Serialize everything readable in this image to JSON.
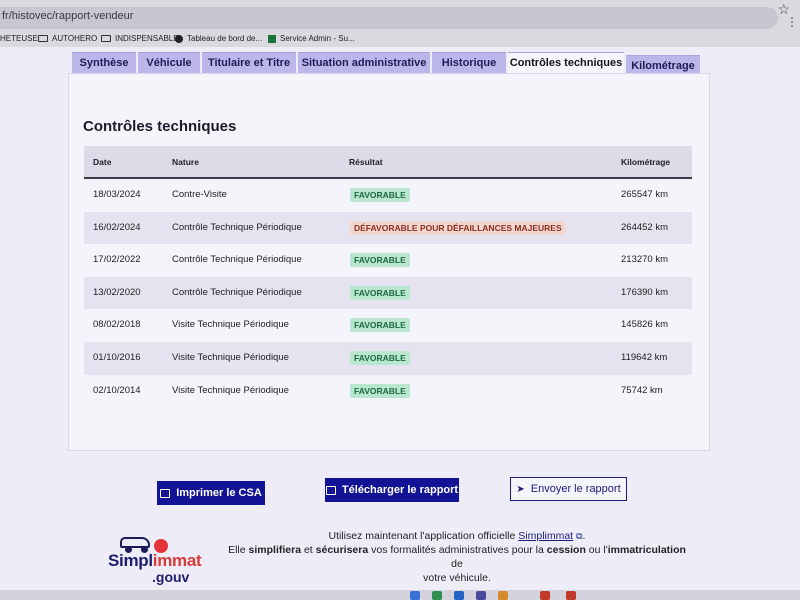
{
  "browser": {
    "url": "fr/histovec/rapport-vendeur",
    "bookmarks": [
      {
        "label": "HETEUSE",
        "icon": "none"
      },
      {
        "label": "AUTOHERO",
        "icon": "folder-icon"
      },
      {
        "label": "INDISPENSABLE",
        "icon": "folder-icon"
      },
      {
        "label": "Tableau de bord de...",
        "icon": "circle-icon"
      },
      {
        "label": "Service Admin - Su...",
        "icon": "grid-icon"
      }
    ]
  },
  "tabs": [
    {
      "label": "Synthèse"
    },
    {
      "label": "Véhicule"
    },
    {
      "label": "Titulaire et Titre"
    },
    {
      "label": "Situation administrative"
    },
    {
      "label": "Historique"
    },
    {
      "label": "Contrôles techniques",
      "active": true
    },
    {
      "label": "Kilométrage"
    }
  ],
  "section": {
    "title": "Contrôles techniques",
    "columns": {
      "date": "Date",
      "nature": "Nature",
      "result": "Résultat",
      "mileage": "Kilométrage"
    },
    "rows": [
      {
        "date": "18/03/2024",
        "nature": "Contre-Visite",
        "result": "FAVORABLE",
        "status": "ok",
        "mileage": "265547 km"
      },
      {
        "date": "16/02/2024",
        "nature": "Contrôle Technique Périodique",
        "result": "DÉFAVORABLE POUR DÉFAILLANCES MAJEURES",
        "status": "ko",
        "mileage": "264452 km"
      },
      {
        "date": "17/02/2022",
        "nature": "Contrôle Technique Périodique",
        "result": "FAVORABLE",
        "status": "ok",
        "mileage": "213270 km"
      },
      {
        "date": "13/02/2020",
        "nature": "Contrôle Technique Périodique",
        "result": "FAVORABLE",
        "status": "ok",
        "mileage": "176390 km"
      },
      {
        "date": "08/02/2018",
        "nature": "Visite Technique Périodique",
        "result": "FAVORABLE",
        "status": "ok",
        "mileage": "145826 km"
      },
      {
        "date": "01/10/2016",
        "nature": "Visite Technique Périodique",
        "result": "FAVORABLE",
        "status": "ok",
        "mileage": "119642 km"
      },
      {
        "date": "02/10/2014",
        "nature": "Visite Technique Périodique",
        "result": "FAVORABLE",
        "status": "ok",
        "mileage": "75742 km"
      }
    ]
  },
  "actions": {
    "print_csa": "Imprimer le CSA",
    "download_report": "Télécharger le rapport",
    "send_report": "Envoyer le rapport"
  },
  "promo": {
    "logo_main_a": "Simpl",
    "logo_main_b": "immat",
    "logo_sub": ".gouv",
    "line1_prefix": "Utilisez maintenant l'application officielle ",
    "line1_link": "Simplimmat",
    "line1_suffix": ".",
    "line2_a": "Elle ",
    "line2_b": "simplifiera",
    "line2_c": " et ",
    "line2_d": "sécurisera",
    "line2_e": " vos formalités administratives pour la ",
    "line2_f": "cession",
    "line2_g": " ou l'",
    "line2_h": "immatriculation",
    "line2_i": " de",
    "line3": "votre véhicule."
  },
  "colors": {
    "primary": "#131396",
    "tab_bg": "#bbb7ea",
    "badge_ok_bg": "#b8e6cf",
    "badge_ko_bg": "#f2d7d1"
  }
}
